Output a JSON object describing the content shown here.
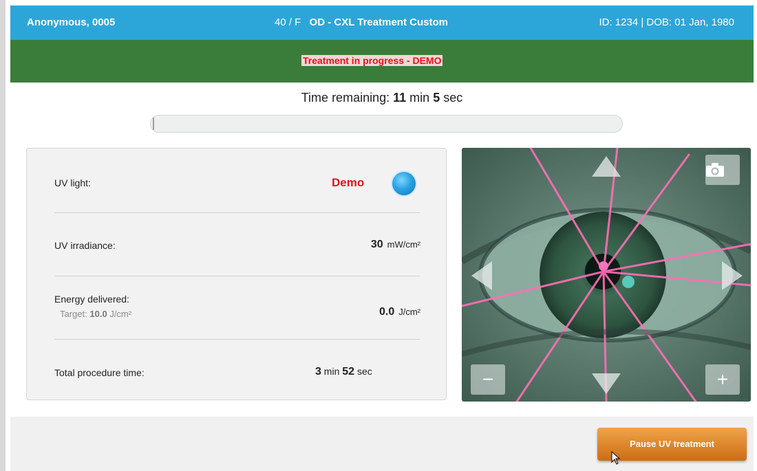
{
  "header": {
    "patient_name": "Anonymous, 0005",
    "age_sex": "40 / F",
    "treatment_title": "OD - CXL Treatment Custom",
    "patient_id": "ID: 1234 | DOB: 01 Jan, 1980"
  },
  "status": {
    "message": "Treatment in progress - DEMO"
  },
  "timer": {
    "prefix": "Time remaining:",
    "minutes": "11",
    "min_unit": "min",
    "seconds": "5",
    "sec_unit": "sec",
    "progress_fraction": 0.0
  },
  "panel": {
    "uv_light": {
      "label": "UV light:",
      "value": "Demo",
      "indicator_color": "#29a3e3"
    },
    "irradiance": {
      "label": "UV irradiance:",
      "value": "30",
      "unit": "mW/cm²"
    },
    "energy": {
      "label": "Energy delivered:",
      "target_label": "Target:",
      "target_value": "10.0",
      "target_unit": "J/cm²",
      "value": "0.0",
      "unit": "J/cm²"
    },
    "procedure_time": {
      "label": "Total procedure time:",
      "minutes": "3",
      "min_unit": "min",
      "seconds": "52",
      "sec_unit": "sec"
    }
  },
  "camera": {
    "snapshot_icon": "camera-icon",
    "zoom_out": "−",
    "zoom_in": "+",
    "arrows": [
      "arrow-up-icon",
      "arrow-down-icon",
      "arrow-left-icon",
      "arrow-right-icon"
    ]
  },
  "actions": {
    "pause_label": "Pause UV treatment"
  },
  "colors": {
    "header_blue": "#2ca6d9",
    "status_green": "#3a7d3a",
    "alert_red": "#e2131b",
    "button_orange": "#e08424"
  }
}
